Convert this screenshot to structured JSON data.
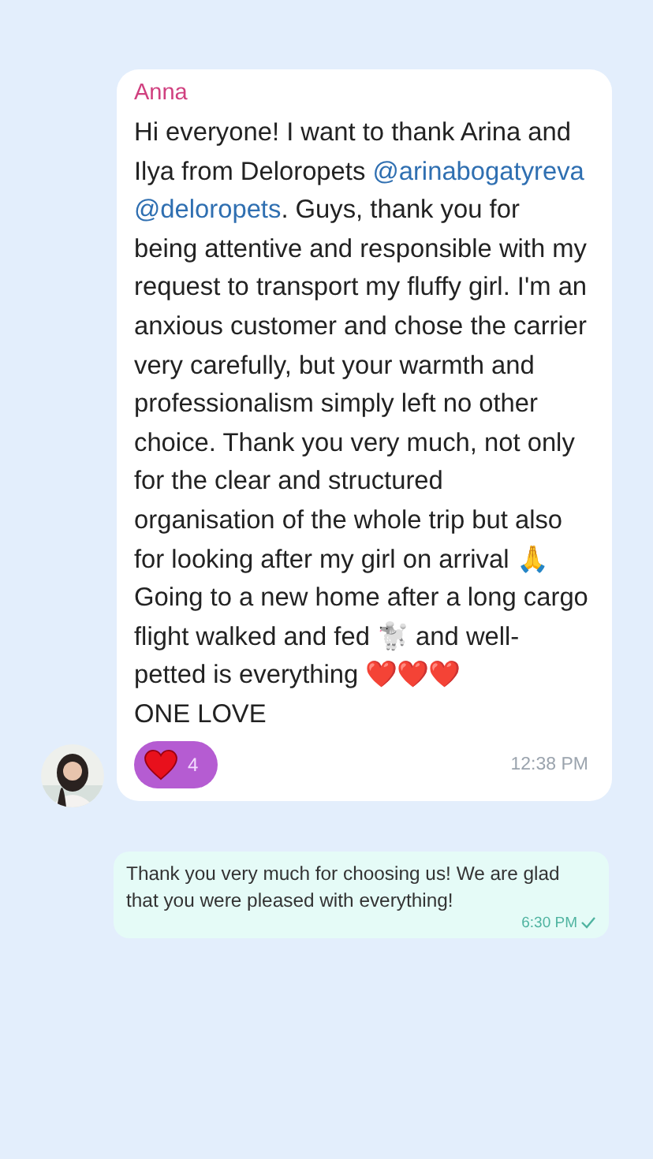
{
  "messages": [
    {
      "kind": "incoming",
      "sender": "Anna",
      "body": [
        {
          "kind": "text",
          "text": "Hi everyone! I want to thank Arina and Ilya from Deloropets "
        },
        {
          "kind": "mention",
          "text": "@arinabogatyreva"
        },
        {
          "kind": "mention",
          "text": "@deloropets"
        },
        {
          "kind": "text",
          "text": ". Guys, thank you for being attentive and responsible with my request to transport my fluffy girl. I'm an anxious customer and chose the carrier very carefully, but your warmth and professionalism simply left no other choice. Thank you very much, not only for the clear and structured organisation of the whole trip but also for looking after my girl on arrival 🙏\nGoing to a new home after a long cargo flight walked and fed 🐩 and well-petted is everything ❤️❤️❤️\nONE LOVE"
        }
      ],
      "reaction": {
        "count": "4"
      },
      "time": "12:38 PM"
    },
    {
      "kind": "outgoing",
      "body": [
        {
          "kind": "text",
          "text": "Thank you very much for choosing us! We are glad that you were pleased with everything!"
        }
      ],
      "time": "6:30 PM",
      "read": true
    }
  ]
}
